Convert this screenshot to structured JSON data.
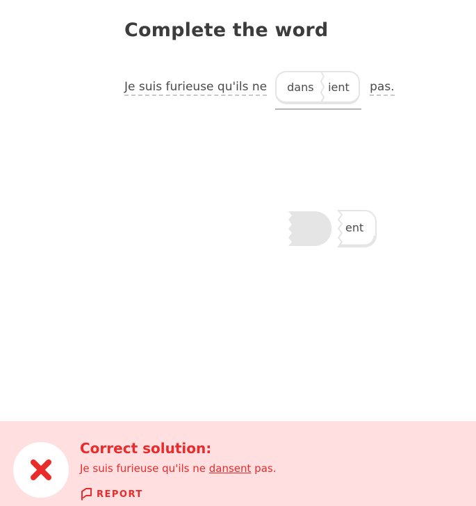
{
  "challenge": {
    "title": "Complete the word",
    "sentence_prefix": "Je suis furieuse qu'ils ne",
    "answer_part1": "dans",
    "answer_part2": "ient",
    "sentence_suffix": "pas."
  },
  "word_bank": {
    "tokens": [
      "ent"
    ]
  },
  "feedback": {
    "heading": "Correct solution:",
    "solution_prefix": "Je suis furieuse qu'ils ne ",
    "solution_highlight": "dansent",
    "solution_suffix": " pas.",
    "report_label": "REPORT",
    "status_icon": "close-icon",
    "accent_color": "#ea2b2b",
    "background_color": "#ffdfe0"
  }
}
